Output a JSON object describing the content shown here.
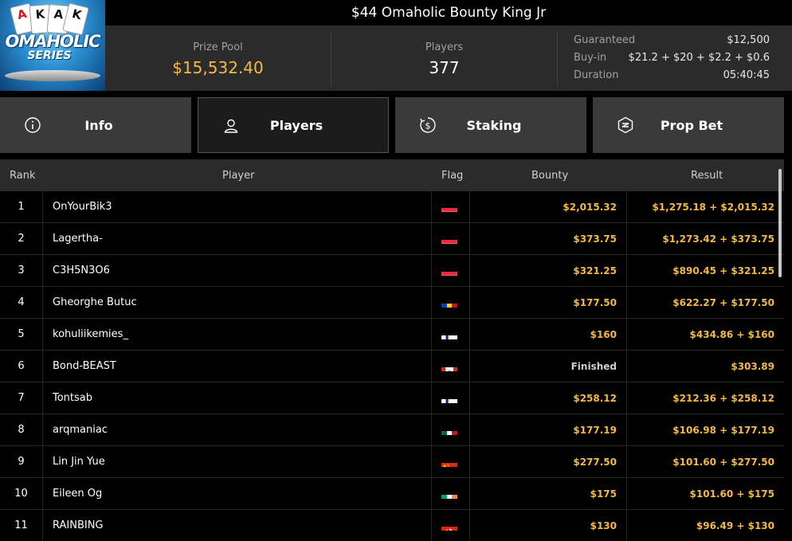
{
  "header": {
    "title": "$44 Omaholic Bounty King Jr",
    "logo": {
      "word1": "OMAHOLIC",
      "word2": "SERIES",
      "cards": [
        "A",
        "K",
        "A",
        "K"
      ]
    },
    "prize_pool": {
      "label": "Prize Pool",
      "value": "$15,532.40"
    },
    "players": {
      "label": "Players",
      "value": "377"
    },
    "details": [
      {
        "label": "Guaranteed",
        "value": "$12,500"
      },
      {
        "label": "Buy-in",
        "value": "$21.2 + $20 + $2.2 + $0.6"
      },
      {
        "label": "Duration",
        "value": "05:40:45"
      }
    ]
  },
  "tabs": [
    {
      "label": "Info",
      "icon": "info-icon",
      "active": false
    },
    {
      "label": "Players",
      "icon": "user-icon",
      "active": true
    },
    {
      "label": "Staking",
      "icon": "dollar-coin-icon",
      "active": false
    },
    {
      "label": "Prop Bet",
      "icon": "prop-bet-icon",
      "active": false
    }
  ],
  "table": {
    "columns": {
      "rank": "Rank",
      "player": "Player",
      "flag": "Flag",
      "bounty": "Bounty",
      "result": "Result"
    },
    "rows": [
      {
        "rank": "1",
        "player": "OnYourBik3",
        "flag": "austria",
        "bounty": "$2,015.32",
        "result": "$1,275.18 + $2,015.32"
      },
      {
        "rank": "2",
        "player": "Lagertha-",
        "flag": "austria",
        "bounty": "$373.75",
        "result": "$1,273.42 + $373.75"
      },
      {
        "rank": "3",
        "player": "C3H5N3O6",
        "flag": "austria",
        "bounty": "$321.25",
        "result": "$890.45 + $321.25"
      },
      {
        "rank": "4",
        "player": "Gheorghe Butuc",
        "flag": "moldova",
        "bounty": "$177.50",
        "result": "$622.27 + $177.50"
      },
      {
        "rank": "5",
        "player": "kohuliikemies_",
        "flag": "finland",
        "bounty": "$160",
        "result": "$434.86 + $160"
      },
      {
        "rank": "6",
        "player": "Bond-BEAST",
        "flag": "canada",
        "bounty": "Finished",
        "result": "$303.89"
      },
      {
        "rank": "7",
        "player": "Tontsab",
        "flag": "finland",
        "bounty": "$258.12",
        "result": "$212.36 + $258.12"
      },
      {
        "rank": "8",
        "player": "arqmaniac",
        "flag": "mexico",
        "bounty": "$177.19",
        "result": "$106.98 + $177.19"
      },
      {
        "rank": "9",
        "player": "Lin Jin Yue",
        "flag": "china",
        "bounty": "$277.50",
        "result": "$101.60 + $277.50"
      },
      {
        "rank": "10",
        "player": "Eileen Og",
        "flag": "ireland",
        "bounty": "$175",
        "result": "$101.60 + $175"
      },
      {
        "rank": "11",
        "player": "RAINBING",
        "flag": "hong-kong",
        "bounty": "$130",
        "result": "$96.49 + $130"
      }
    ]
  },
  "colors": {
    "accent_gold": "#f5b942",
    "panel": "#2b2b2b",
    "tab": "#3a3a3a"
  }
}
